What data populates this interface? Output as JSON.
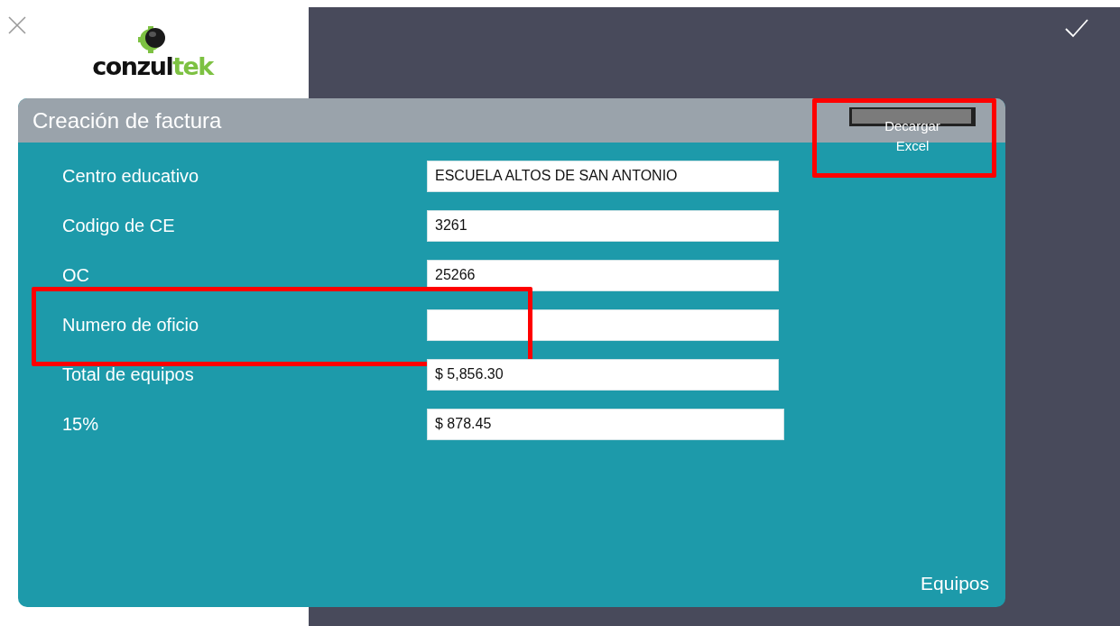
{
  "logo": {
    "dark": "conzul",
    "accent": "tek"
  },
  "form": {
    "title": "Creación de factura",
    "export_button": {
      "label": "Decargar Excel",
      "highlighted": true
    },
    "fields": [
      {
        "label": "Centro educativo",
        "value": "ESCUELA ALTOS DE SAN ANTONIO",
        "highlighted": false
      },
      {
        "label": "Codigo de CE",
        "value": "3261",
        "highlighted": false
      },
      {
        "label": "OC",
        "value": "25266",
        "highlighted": false
      },
      {
        "label": "Numero de oficio",
        "highlighted": true
      },
      {
        "label": "Total de equipos",
        "value": "$ 5,856.30",
        "highlighted": false
      },
      {
        "label": "15%",
        "value": "$ 878.45",
        "highlighted": false
      }
    ],
    "footer_link": "Equipos"
  }
}
